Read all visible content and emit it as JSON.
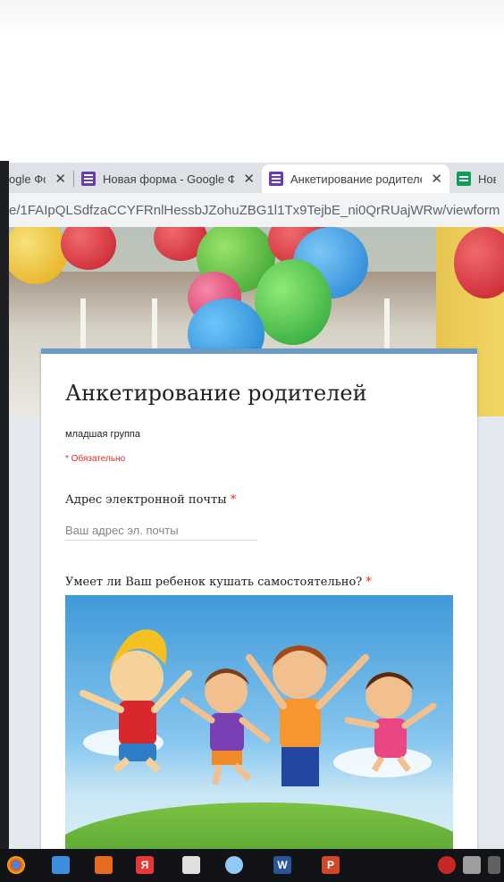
{
  "browser": {
    "tabs": [
      {
        "title": "ogle Фо",
        "icon": "google-forms-icon"
      },
      {
        "title": "Новая форма - Google Фо",
        "icon": "google-forms-icon"
      },
      {
        "title": "Анкетирование родителей",
        "icon": "google-forms-icon",
        "active": true
      },
      {
        "title": "Нов",
        "icon": "google-sheets-icon"
      }
    ],
    "close_glyph": "✕",
    "url": "e/1FAIpQLSdfzaCCYFRnlHessbJZohuZBG1l1Tx9TejbE_ni0QrRUajWRw/viewform"
  },
  "form": {
    "title": "Анкетирование родителей",
    "description": "младшая группа",
    "required_note": "* Обязательно",
    "questions": [
      {
        "label": "Адрес электронной почты",
        "required_mark": "*",
        "placeholder": "Ваш адрес эл. почты"
      },
      {
        "label": "Умеет ли Ваш ребенок кушать самостоятельно?",
        "required_mark": "*"
      }
    ]
  },
  "colors": {
    "accent": "#673ab7",
    "card_border": "#6b9ac4",
    "required": "#d93025"
  },
  "taskbar": {
    "icons": [
      "chrome-icon",
      "notes-icon",
      "media-player-icon",
      "yandex-browser-icon",
      "mail-icon",
      "paint-icon",
      "word-icon",
      "powerpoint-icon",
      "security-icon",
      "network-icon",
      "notification-icon"
    ],
    "yandex_label": "Я",
    "word_label": "W",
    "ppt_label": "P"
  }
}
